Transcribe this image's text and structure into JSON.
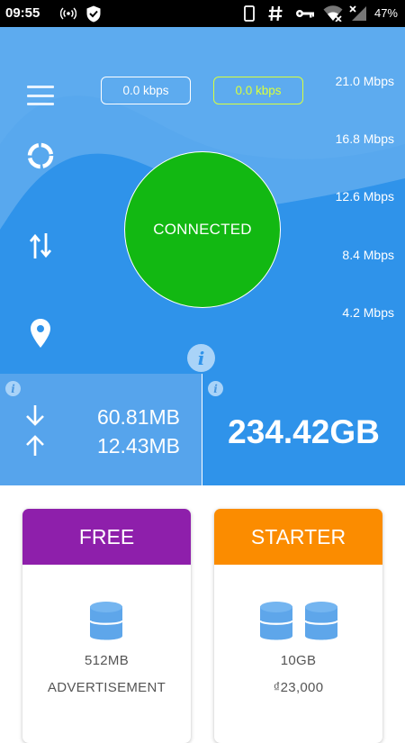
{
  "status_bar": {
    "time": "09:55",
    "battery": "47%",
    "icons": [
      "hotspot-icon",
      "shield-icon",
      "phone-icon",
      "hash-icon",
      "key-icon",
      "wifi-icon",
      "signal-icon"
    ]
  },
  "speed": {
    "download_kbps": "0.0 kbps",
    "upload_kbps": "0.0 kbps",
    "scale": [
      "21.0 Mbps",
      "16.8 Mbps",
      "12.6 Mbps",
      "8.4 Mbps",
      "4.2 Mbps"
    ]
  },
  "connection": {
    "status_label": "CONNECTED",
    "info_glyph": "i"
  },
  "usage": {
    "download": "60.81MB",
    "upload": "12.43MB",
    "total": "234.42GB",
    "info_glyph": "i"
  },
  "plans": [
    {
      "name": "FREE",
      "data": "512MB",
      "detail": "ADVERTISEMENT",
      "color": "#8e1fab"
    },
    {
      "name": "STARTER",
      "data": "10GB",
      "detail": "₫23,000",
      "color": "#fb8c00"
    }
  ],
  "colors": {
    "primary": "#2f93ea",
    "connected": "#12b812",
    "upload_accent": "#d8ff3c",
    "icon_blue": "#5aa3e8"
  }
}
